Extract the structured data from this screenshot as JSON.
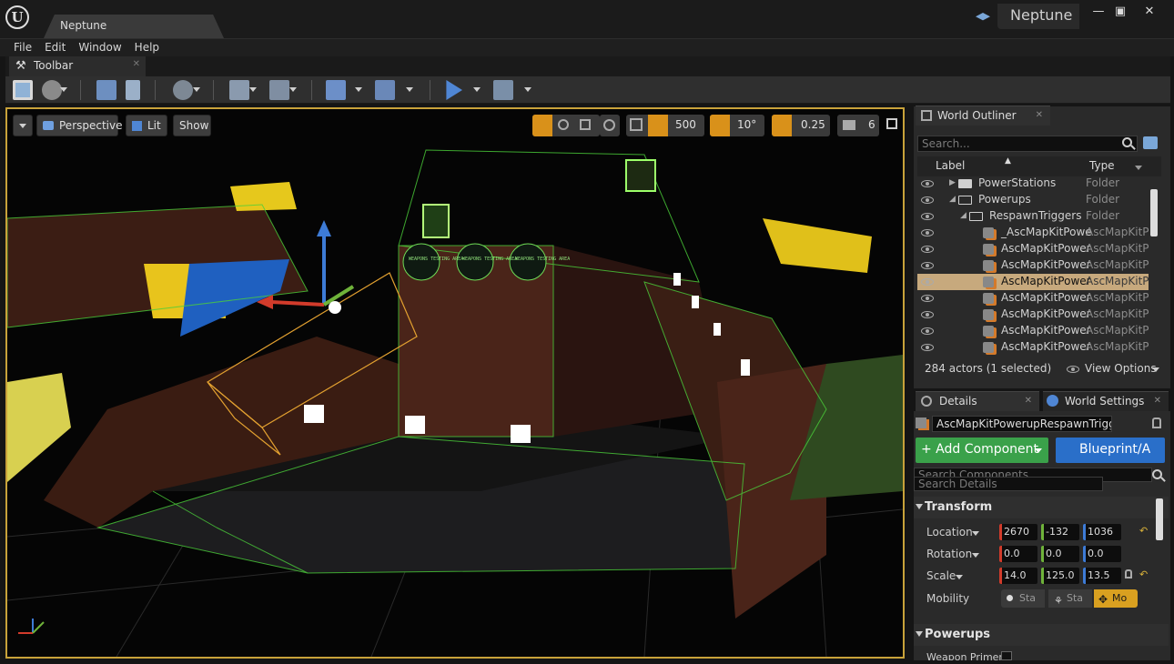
{
  "window": {
    "title": "Neptune",
    "project": "Neptune"
  },
  "menu": [
    "File",
    "Edit",
    "Window",
    "Help"
  ],
  "toolbar_tab": {
    "label": "Toolbar"
  },
  "viewport": {
    "perspective": "Perspective",
    "lit": "Lit",
    "show": "Show",
    "grid_snap": "500",
    "rot_snap": "10°",
    "scale_snap": "0.25",
    "camera_speed": "6",
    "signs": [
      "WEAPONS TESTING AREA",
      "WEAPONS TESTING AREA",
      "WEAPONS TESTING AREA"
    ]
  },
  "outliner": {
    "tab": "World Outliner",
    "search_placeholder": "Search...",
    "col_label": "Label",
    "col_type": "Type",
    "rows": [
      {
        "label": "PowerStations",
        "type": "Folder"
      },
      {
        "label": "Powerups",
        "type": "Folder"
      },
      {
        "label": "RespawnTriggers",
        "type": "Folder"
      },
      {
        "label": "_AscMapKitPowe",
        "type": "AscMapKitP"
      },
      {
        "label": "AscMapKitPower",
        "type": "AscMapKitP"
      },
      {
        "label": "AscMapKitPower",
        "type": "AscMapKitP"
      },
      {
        "label": "AscMapKitPower",
        "type": "AscMapKitP"
      },
      {
        "label": "AscMapKitPower",
        "type": "AscMapKitP"
      },
      {
        "label": "AscMapKitPower",
        "type": "AscMapKitP"
      },
      {
        "label": "AscMapKitPower",
        "type": "AscMapKitP"
      },
      {
        "label": "AscMapKitPower",
        "type": "AscMapKitP"
      }
    ],
    "actor_count": "284 actors (1 selected)",
    "view_options": "View Options"
  },
  "details": {
    "tab": "Details",
    "tab2": "World Settings",
    "object_name": "AscMapKitPowerupRespawnTrigge",
    "add_component": "+ Add Component",
    "blueprint": "Blueprint/A",
    "search_components": "Search Components",
    "search_details": "Search Details",
    "transform_header": "Transform",
    "location_label": "Location",
    "rotation_label": "Rotation",
    "scale_label": "Scale",
    "mobility_label": "Mobility",
    "location": [
      "2670",
      "-132",
      "1036"
    ],
    "rotation": [
      "0.0",
      "0.0",
      "0.0"
    ],
    "scale": [
      "14.0",
      "125.0",
      "13.5"
    ],
    "mobility": [
      "Sta",
      "Sta",
      "Mo"
    ],
    "powerups_header": "Powerups",
    "weapon_primer": "Weapon Primer"
  },
  "colors": {
    "accent_orange": "#c8a23a",
    "x_red": "#d23b2b",
    "y_green": "#6fb33a",
    "z_blue": "#3d7bd6",
    "selected_row": "#c7a97d"
  }
}
